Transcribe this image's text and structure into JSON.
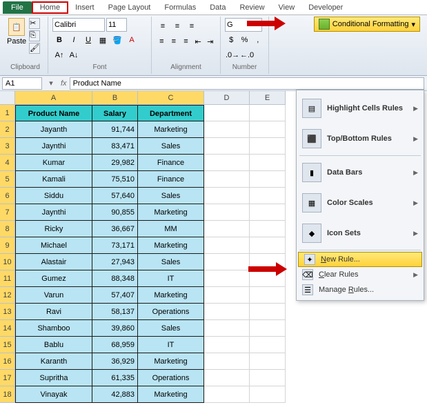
{
  "tabs": [
    "File",
    "Home",
    "Insert",
    "Page Layout",
    "Formulas",
    "Data",
    "Review",
    "View",
    "Developer"
  ],
  "ribbon": {
    "clipboard_label": "Clipboard",
    "paste_label": "Paste",
    "font_label": "Font",
    "font_name": "Calibri",
    "font_size": "11",
    "align_label": "Alignment",
    "number_label": "Number",
    "cf_label": "Conditional Formatting"
  },
  "namebox": "A1",
  "formula": "Product Name",
  "columns": [
    "A",
    "B",
    "C",
    "D",
    "E"
  ],
  "rows": [
    "1",
    "2",
    "3",
    "4",
    "5",
    "6",
    "7",
    "8",
    "9",
    "10",
    "11",
    "12",
    "13",
    "14",
    "15",
    "16",
    "17",
    "18"
  ],
  "headers": [
    "Product Name",
    "Salary",
    "Department"
  ],
  "data": [
    [
      "Jayanth",
      "91,744",
      "Marketing"
    ],
    [
      "Jaynthi",
      "83,471",
      "Sales"
    ],
    [
      "Kumar",
      "29,982",
      "Finance"
    ],
    [
      "Kamali",
      "75,510",
      "Finance"
    ],
    [
      "Siddu",
      "57,640",
      "Sales"
    ],
    [
      "Jaynthi",
      "90,855",
      "Marketing"
    ],
    [
      "Ricky",
      "36,667",
      "MM"
    ],
    [
      "Michael",
      "73,171",
      "Marketing"
    ],
    [
      "Alastair",
      "27,943",
      "Sales"
    ],
    [
      "Gumez",
      "88,348",
      "IT"
    ],
    [
      "Varun",
      "57,407",
      "Marketing"
    ],
    [
      "Ravi",
      "58,137",
      "Operations"
    ],
    [
      "Shamboo",
      "39,860",
      "Sales"
    ],
    [
      "Bablu",
      "68,959",
      "IT"
    ],
    [
      "Karanth",
      "36,929",
      "Marketing"
    ],
    [
      "Supritha",
      "61,335",
      "Operations"
    ],
    [
      "Vinayak",
      "42,883",
      "Marketing"
    ]
  ],
  "dropdown": {
    "highlight": "Highlight Cells Rules",
    "topbottom": "Top/Bottom Rules",
    "databars": "Data Bars",
    "colorscales": "Color Scales",
    "iconsets": "Icon Sets",
    "newrule": "New Rule...",
    "clearrules": "Clear Rules",
    "manage": "Manage Rules..."
  }
}
